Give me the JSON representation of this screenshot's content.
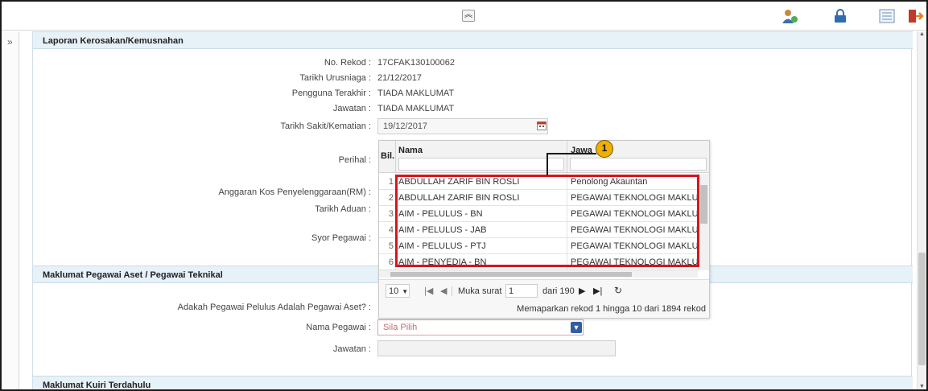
{
  "toolbar": {
    "collapse_symbol": "︽"
  },
  "sidebar": {
    "expand_symbol": "»"
  },
  "section1": {
    "title": "Laporan Kerosakan/Kemusnahan",
    "fields": [
      {
        "label": "No. Rekod :",
        "value": "17CFAK130100062"
      },
      {
        "label": "Tarikh Urusniaga :",
        "value": "21/12/2017"
      },
      {
        "label": "Pengguna Terakhir :",
        "value": "TIADA MAKLUMAT"
      },
      {
        "label": "Jawatan :",
        "value": "TIADA MAKLUMAT"
      }
    ],
    "tarikh_sakit_label": "Tarikh Sakit/Kematian :",
    "tarikh_sakit_value": "19/12/2017",
    "perihal_label": "Perihal :",
    "anggaran_label": "Anggaran Kos Penyelenggaraan(RM) :",
    "tarikh_aduan_label": "Tarikh Aduan :",
    "syor_label": "Syor Pegawai :"
  },
  "grid": {
    "col_bil": "Bil.",
    "col_nama": "Nama",
    "col_jawatan": "Jawa",
    "rows": [
      {
        "bil": "1",
        "nama": "ABDULLAH ZARIF BIN ROSLI",
        "jawatan": "Penolong Akauntan"
      },
      {
        "bil": "2",
        "nama": "ABDULLAH ZARIF BIN ROSLI",
        "jawatan": "PEGAWAI TEKNOLOGI MAKLUMAT"
      },
      {
        "bil": "3",
        "nama": "AIM - PELULUS - BN",
        "jawatan": "PEGAWAI TEKNOLOGI MAKLUMAT"
      },
      {
        "bil": "4",
        "nama": "AIM - PELULUS - JAB",
        "jawatan": "PEGAWAI TEKNOLOGI MAKLUMAT"
      },
      {
        "bil": "5",
        "nama": "AIM - PELULUS - PTJ",
        "jawatan": "PEGAWAI TEKNOLOGI MAKLUMAT"
      },
      {
        "bil": "6",
        "nama": "AIM - PENYEDIA - BN",
        "jawatan": "PEGAWAI TEKNOLOGI MAKLUMAT"
      }
    ],
    "page_size": "10",
    "page_label": "Muka surat",
    "page_value": "1",
    "page_total": "dari 190",
    "summary": "Memaparkan rekod 1 hingga 10 dari 1894 rekod"
  },
  "callout": {
    "number": "1"
  },
  "section2": {
    "title": "Maklumat Pegawai Aset / Pegawai Teknikal",
    "adakah_label": "Adakah Pegawai Pelulus Adalah Pegawai Aset? :",
    "nama_label": "Nama Pegawai :",
    "nama_placeholder": "Sila Pilih",
    "jawatan_label": "Jawatan :"
  },
  "section3": {
    "title": "Maklumat Kuiri Terdahulu"
  },
  "colors": {
    "header_bg": "#e6f1f8",
    "callout_red": "#d9141b",
    "callout_circle": "#f0b000"
  }
}
